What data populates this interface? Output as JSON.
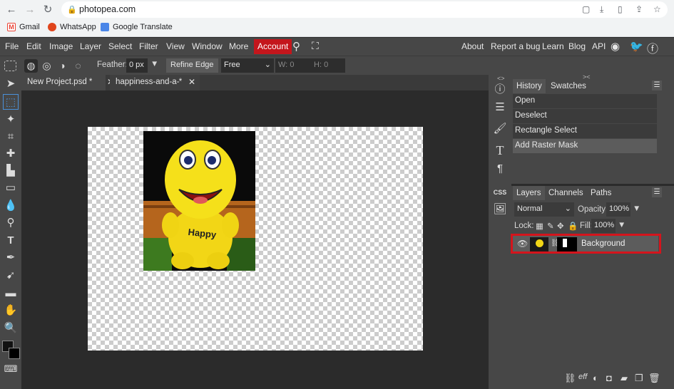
{
  "browser": {
    "url": "photopea.com",
    "bookmarks": [
      "Gmail",
      "WhatsApp",
      "Google Translate"
    ]
  },
  "menu": {
    "items": [
      "File",
      "Edit",
      "Image",
      "Layer",
      "Select",
      "Filter",
      "View",
      "Window",
      "More"
    ],
    "account": "Account",
    "right_items": [
      "About",
      "Report a bug",
      "Learn",
      "Blog",
      "API"
    ]
  },
  "options": {
    "feather_label": "Feather:",
    "feather_value": "0 px",
    "refine_edge": "Refine Edge",
    "style_value": "Free",
    "w_label": "W:",
    "w_value": "0",
    "h_label": "H:",
    "h_value": "0"
  },
  "tabs": [
    {
      "label": "New Project.psd *"
    },
    {
      "label": "happiness-and-a-"
    }
  ],
  "history": {
    "tab": "History",
    "tab2": "Swatches",
    "items": [
      "Open",
      "Deselect",
      "Rectangle Select",
      "Add Raster Mask"
    ]
  },
  "layers": {
    "tabs": [
      "Layers",
      "Channels",
      "Paths"
    ],
    "blend": "Normal",
    "opacity_label": "Opacity:",
    "opacity_value": "100%",
    "lock_label": "Lock:",
    "fill_label": "Fill:",
    "fill_value": "100%",
    "layer_name": "Background"
  },
  "side_icons": [
    "info-icon",
    "adjust-icon",
    "brush-icon",
    "text-icon",
    "paragraph-icon",
    "css-label",
    "image-icon"
  ],
  "side_css": "CSS",
  "colors": {
    "accent_red": "#c4161c",
    "highlight_red": "#d4141c",
    "panel": "#474747"
  }
}
